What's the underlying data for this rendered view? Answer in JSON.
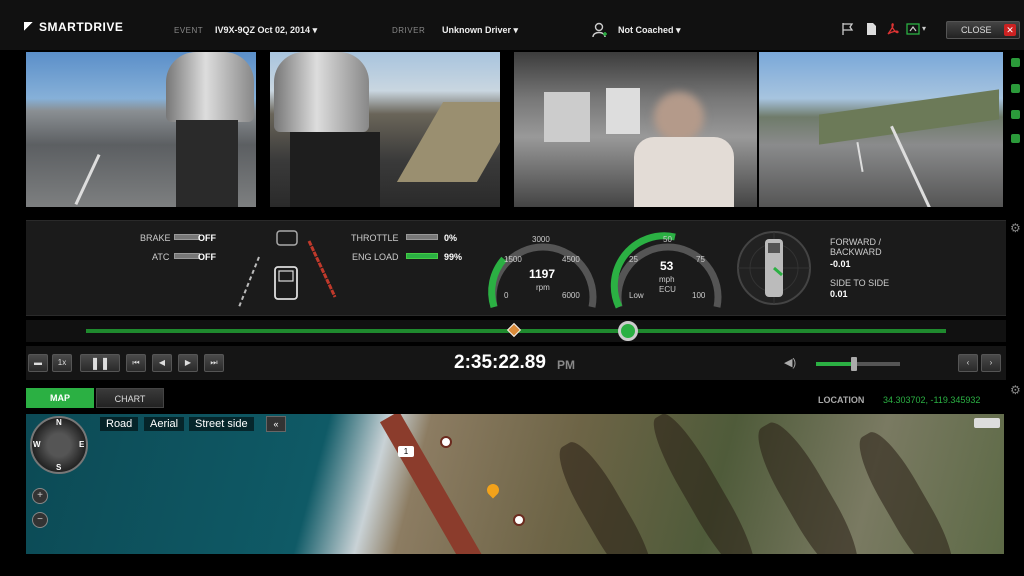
{
  "header": {
    "logo": "SMARTDRIVE",
    "event_label": "EVENT",
    "event_value": "IV9X-9QZ Oct 02, 2014",
    "driver_label": "DRIVER",
    "driver_value": "Unknown Driver",
    "coaching_status": "Not Coached",
    "close_label": "CLOSE",
    "close_x": "✕",
    "icons": [
      "flag-icon",
      "document-icon",
      "pdf-icon",
      "export-icon"
    ]
  },
  "telemetry": {
    "brake_label": "BRAKE",
    "brake_value": "OFF",
    "atc_label": "ATC",
    "atc_value": "OFF",
    "throttle_label": "THROTTLE",
    "throttle_value": "0%",
    "eng_load_label": "ENG LOAD",
    "eng_load_value": "99%",
    "rpm": {
      "value": "1197",
      "unit": "rpm",
      "ticks": [
        "0",
        "1500",
        "3000",
        "4500",
        "6000"
      ]
    },
    "speed": {
      "value": "53",
      "unit": "mph",
      "source": "ECU",
      "ticks": [
        "Low",
        "25",
        "50",
        "75",
        "100"
      ]
    },
    "g_force": {
      "fwd_label": "FORWARD / BACKWARD",
      "fwd_value": "-0.01",
      "side_label": "SIDE TO SIDE",
      "side_value": "0.01"
    }
  },
  "playback": {
    "speed_label": "1x",
    "time": "2:35:22.89",
    "ampm": "PM",
    "progress_fraction": 0.63,
    "volume_fraction": 0.45
  },
  "map_panel": {
    "tabs": [
      "MAP",
      "CHART"
    ],
    "location_label": "LOCATION",
    "location_value": "34.303702, -119.345932",
    "map_types": [
      "Road",
      "Aerial",
      "Street side"
    ],
    "collapse_label": "«",
    "compass": {
      "n": "N",
      "s": "S",
      "e": "E",
      "w": "W"
    },
    "route_shield": "1"
  }
}
